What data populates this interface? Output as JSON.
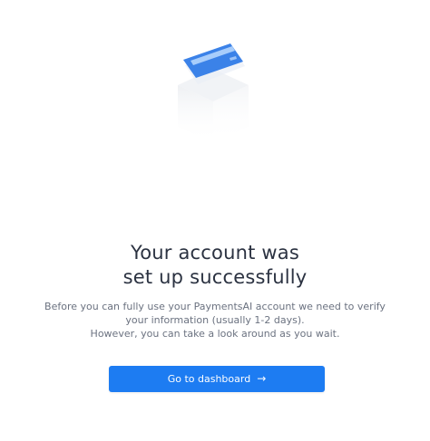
{
  "illustration": {
    "icon": "credit-card-icon",
    "card_color": "#3b82e8",
    "stripe_color": "#a8cdfb",
    "box_color": "#f3f4f6"
  },
  "heading": {
    "line1": "Your account was",
    "line2": "set up successfully"
  },
  "description": {
    "line1": "Before you can fully use your PaymentsAI account we need to verify",
    "line2": "your information (usually 1-2 days).",
    "line3": "However, you can take a look around as you wait."
  },
  "cta": {
    "label": "Go to dashboard",
    "icon": "arrow-right-icon",
    "icon_glyph": "→",
    "color": "#1d7cf2"
  }
}
